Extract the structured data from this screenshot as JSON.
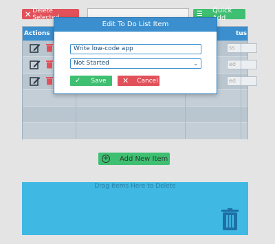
{
  "toolbar": {
    "delete_label": "Delete Selected",
    "quick_add_label": "Quick Add",
    "quick_add_value": ""
  },
  "grid": {
    "col_actions": "Actions",
    "col_status": "tus",
    "rows": [
      {
        "status": "ss"
      },
      {
        "status": "ed"
      },
      {
        "status": "ed"
      }
    ]
  },
  "add_button": {
    "label": "Add New Item"
  },
  "dropzone": {
    "label": "Drag Items Here to Delete"
  },
  "modal": {
    "title": "Edit To Do List Item",
    "name_value": "Write low-code app",
    "status_value": "Not Started",
    "save_label": "Save",
    "cancel_label": "Cancel"
  },
  "colors": {
    "primary": "#3b8fce",
    "success": "#3fbf71",
    "danger": "#e2515a",
    "dropzone": "#3fb8e3"
  }
}
